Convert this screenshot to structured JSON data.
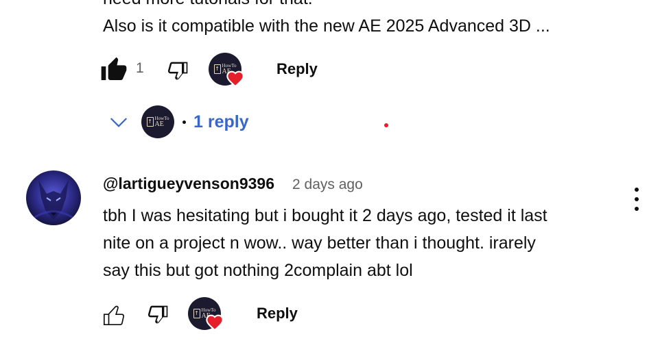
{
  "comment1": {
    "text_cut": "need more tutorials for that.",
    "text_line": "Also is it compatible with the new AE 2025  Advanced 3D ...",
    "like_count": "1",
    "reply_label": "Reply",
    "replies_label": "1 reply"
  },
  "creator_badge": {
    "line1": "HowTo",
    "line2": "AE"
  },
  "comment2": {
    "handle": "@lartigueyvenson9396",
    "time": "2 days ago",
    "body": "tbh I was hesitating but i bought it 2 days ago, tested it last\nnite on a project n wow.. way better than i thought. irarely\nsay this but got nothing 2complain abt lol",
    "reply_label": "Reply"
  },
  "colors": {
    "link": "#3866c9",
    "heart": "#e5202a",
    "badge_bg": "#1c1a2e"
  },
  "icons": [
    "thumb-up-filled-icon",
    "thumb-down-icon",
    "thumb-up-icon",
    "heart-icon",
    "chevron-down-icon",
    "more-vert-icon"
  ]
}
